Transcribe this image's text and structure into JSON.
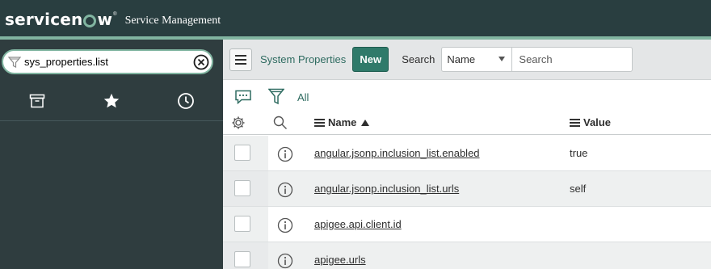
{
  "header": {
    "logo_prefix": "servicen",
    "logo_suffix": "w",
    "logo_reg": "®",
    "app_title": "Service Management",
    "colors": {
      "bar": "#293e40",
      "accent": "#81b5a1"
    }
  },
  "navigator": {
    "filter_value": "sys_properties.list",
    "filter_icon": "funnel-icon",
    "clear_icon": "clear-x-circle-icon",
    "tabs": [
      {
        "name": "archive-icon"
      },
      {
        "name": "star-icon"
      },
      {
        "name": "history-clock-icon"
      }
    ]
  },
  "list": {
    "menu_icon": "hamburger-menu-icon",
    "title": "System Properties",
    "new_label": "New",
    "search_label": "Search",
    "search_field_selected": "Name",
    "search_placeholder": "Search",
    "breadcrumb_all": "All",
    "columns": {
      "name": "Name",
      "value": "Value"
    },
    "rows": [
      {
        "name": "angular.jsonp.inclusion_list.enabled",
        "value": "true"
      },
      {
        "name": "angular.jsonp.inclusion_list.urls",
        "value": "self"
      },
      {
        "name": "apigee.api.client.id",
        "value": ""
      },
      {
        "name": "apigee.urls",
        "value": ""
      }
    ]
  }
}
